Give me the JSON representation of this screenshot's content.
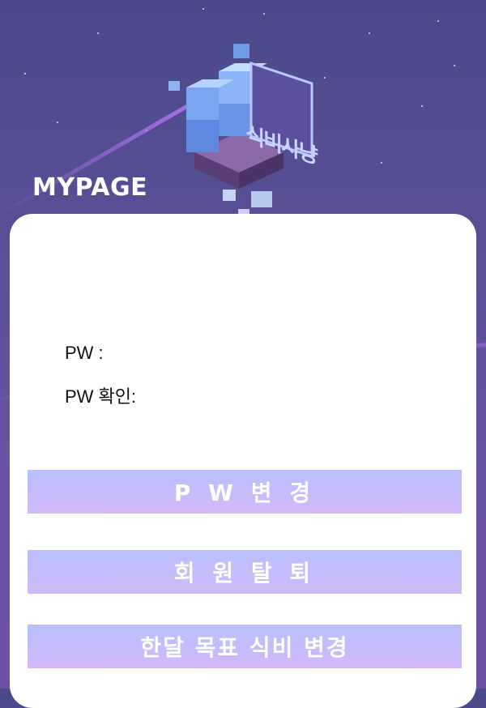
{
  "header": {
    "title": "MYPAGE",
    "logo_text": "식비사냥",
    "logo_icon": "cube-logo-icon"
  },
  "form": {
    "pw_label": "PW :",
    "pw_confirm_label": "PW 확인:",
    "pw_value": "",
    "pw_confirm_value": ""
  },
  "buttons": {
    "change_pw": "P W 변 경",
    "withdraw": "회 원 탈 퇴",
    "change_goal": "한달 목표 식비 변경"
  },
  "colors": {
    "background": "#5a4f96",
    "button_gradient_top": "#b8c0ff",
    "button_gradient_bottom": "#d2b8f8",
    "streak": "#be78ff"
  }
}
